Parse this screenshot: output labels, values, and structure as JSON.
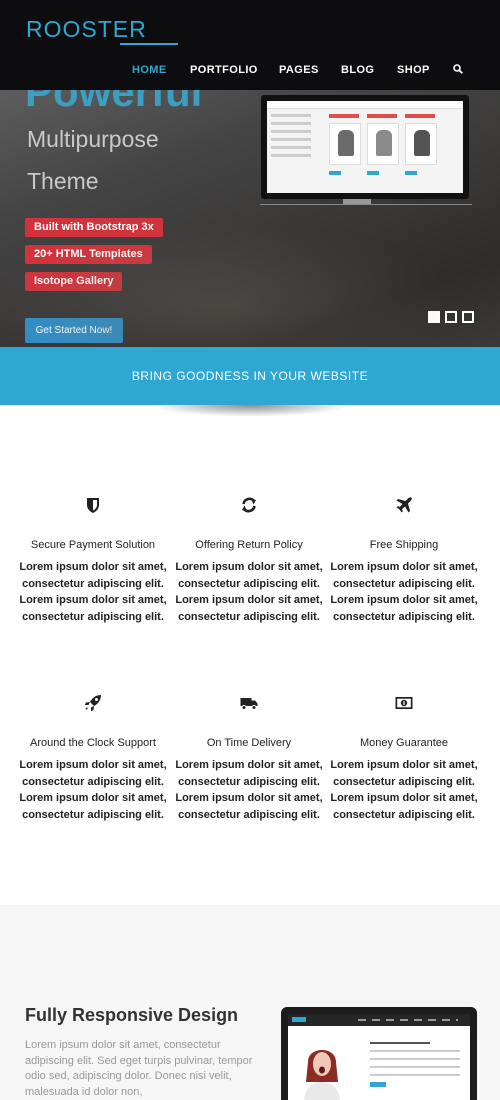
{
  "header": {
    "logo": "ROOSTER",
    "nav": [
      {
        "label": "HOME",
        "active": true
      },
      {
        "label": "PORTFOLIO"
      },
      {
        "label": "PAGES"
      },
      {
        "label": "BLOG"
      },
      {
        "label": "SHOP"
      }
    ],
    "search_icon": "search-icon"
  },
  "hero": {
    "cut_heading": "Powerful",
    "lines": [
      "Multipurpose",
      "Theme"
    ],
    "badges": [
      "Built with Bootstrap 3x",
      "20+ HTML Templates",
      "Isotope Gallery"
    ],
    "cta": "Get Started Now!",
    "slides": {
      "count": 3,
      "active": 1
    }
  },
  "banner": {
    "text": "BRING GOODNESS IN YOUR WEBSITE"
  },
  "features": [
    {
      "icon": "shield-icon",
      "title": "Secure Payment Solution",
      "desc": "Lorem ipsum dolor sit amet, consectetur adipiscing elit. Lorem ipsum dolor sit amet, consectetur adipiscing elit."
    },
    {
      "icon": "refresh-icon",
      "title": "Offering Return Policy",
      "desc": "Lorem ipsum dolor sit amet, consectetur adipiscing elit. Lorem ipsum dolor sit amet, consectetur adipiscing elit."
    },
    {
      "icon": "plane-icon",
      "title": "Free Shipping",
      "desc": "Lorem ipsum dolor sit amet, consectetur adipiscing elit. Lorem ipsum dolor sit amet, consectetur adipiscing elit."
    },
    {
      "icon": "rocket-icon",
      "title": "Around the Clock Support",
      "desc": "Lorem ipsum dolor sit amet, consectetur adipiscing elit. Lorem ipsum dolor sit amet, consectetur adipiscing elit."
    },
    {
      "icon": "truck-icon",
      "title": "On Time Delivery",
      "desc": "Lorem ipsum dolor sit amet, consectetur adipiscing elit. Lorem ipsum dolor sit amet, consectetur adipiscing elit."
    },
    {
      "icon": "money-icon",
      "title": "Money Guarantee",
      "desc": "Lorem ipsum dolor sit amet, consectetur adipiscing elit. Lorem ipsum dolor sit amet, consectetur adipiscing elit."
    }
  ],
  "responsive": {
    "title": "Fully Responsive Design",
    "text": "Lorem ipsum dolor sit amet, consectetur adipiscing elit. Sed eget turpis pulvinar, tempor odio sed, adipiscing dolor. Donec nisi velit, malesuada id dolor non,"
  },
  "colors": {
    "accent": "#2ea8d2",
    "badge": "#d1333c",
    "header": "#0d0d0f"
  }
}
